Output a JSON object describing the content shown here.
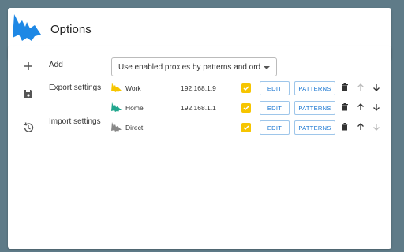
{
  "header": {
    "title": "Options"
  },
  "sidebar": {
    "items": [
      {
        "label": "Add",
        "icon": "plus-icon"
      },
      {
        "label": "Export settings",
        "icon": "save-icon"
      },
      {
        "label": "Import settings",
        "icon": "history-icon"
      }
    ]
  },
  "mode_select": {
    "value": "Use enabled proxies by patterns and ord..."
  },
  "proxies": [
    {
      "name": "Work",
      "address": "192.168.1.9",
      "color": "#f6c500",
      "enabled": true,
      "edit_label": "EDIT",
      "patterns_label": "PATTERNS"
    },
    {
      "name": "Home",
      "address": "192.168.1.1",
      "color": "#21a68d",
      "enabled": true,
      "edit_label": "EDIT",
      "patterns_label": "PATTERNS"
    },
    {
      "name": "Direct",
      "address": "",
      "color": "#888888",
      "enabled": true,
      "edit_label": "EDIT",
      "patterns_label": "PATTERNS"
    }
  ],
  "colors": {
    "background": "#5f7b88",
    "accent": "#1976d2",
    "checkbox": "#f6c500",
    "logo": "#1e88e5"
  }
}
